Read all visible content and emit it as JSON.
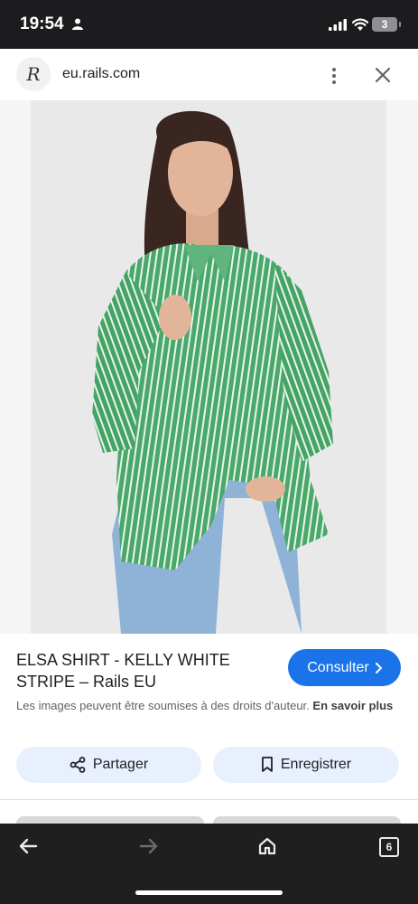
{
  "status_bar": {
    "time": "19:54",
    "battery": "3"
  },
  "browser": {
    "url": "eu.rails.com",
    "tab_count": "6"
  },
  "product": {
    "title": "ELSA SHIRT - KELLY WHITE STRIPE – Rails EU",
    "consult_label": "Consulter",
    "copyright_text": "Les images peuvent être soumises à des droits d'auteur.",
    "learn_more": "En savoir plus"
  },
  "actions": {
    "share_label": "Partager",
    "save_label": "Enregistrer"
  },
  "icons": [
    "person-icon",
    "signal-icon",
    "wifi-icon",
    "more-vert-icon",
    "close-icon",
    "chevron-right-icon",
    "share-icon",
    "bookmark-icon",
    "back-icon",
    "forward-icon",
    "home-icon",
    "tabs-icon"
  ],
  "colors": {
    "accent": "#1a73e8",
    "chip_bg": "#e8f0fe",
    "shirt_green": "#4aa86a"
  }
}
